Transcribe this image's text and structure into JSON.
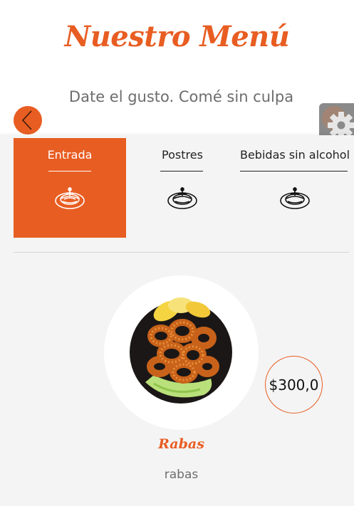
{
  "header": {
    "title": "Nuestro Menú",
    "subtitle": "Date el gusto. Comé sin culpa"
  },
  "nav": {
    "back_icon": "chevron-left-icon",
    "settings_icon": "gear-icon"
  },
  "tabs": [
    {
      "label": "Entrada",
      "icon": "appetizer-plate-icon",
      "active": true
    },
    {
      "label": "Postres",
      "icon": "appetizer-plate-icon",
      "active": false
    },
    {
      "label": "Bebidas sin alcohol",
      "icon": "appetizer-plate-icon",
      "active": false
    }
  ],
  "item": {
    "name": "Rabas",
    "description": "rabas",
    "price": "$300,0"
  },
  "colors": {
    "accent": "#e85d22",
    "panel": "#f4f4f4",
    "settings": "#8a8a8a"
  }
}
